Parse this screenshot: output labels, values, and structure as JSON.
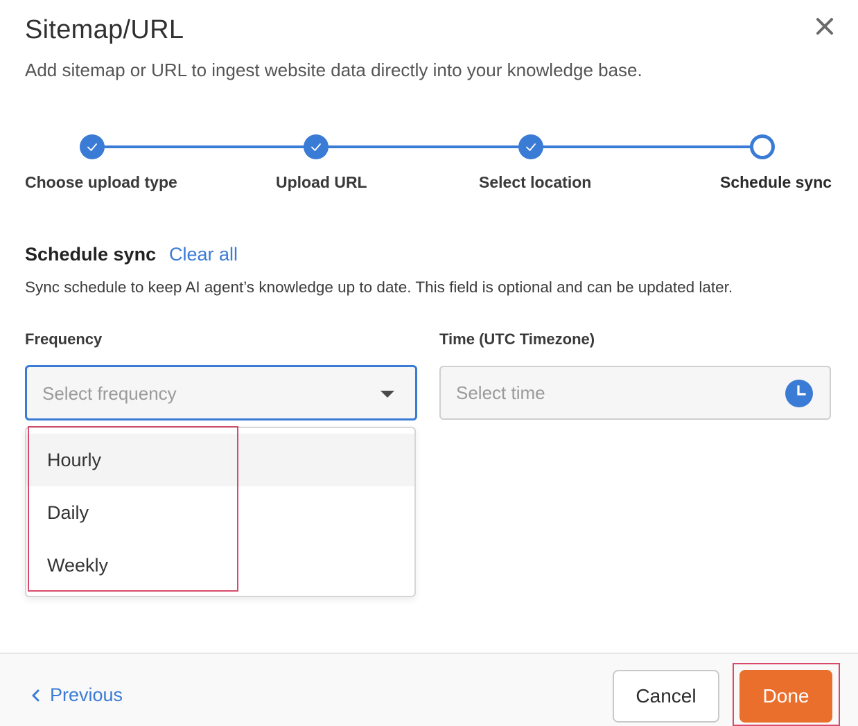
{
  "dialog": {
    "title": "Sitemap/URL",
    "subtitle": "Add sitemap or URL to ingest website data directly into your knowledge base."
  },
  "stepper": {
    "steps": [
      {
        "label": "Choose upload type",
        "state": "complete"
      },
      {
        "label": "Upload URL",
        "state": "complete"
      },
      {
        "label": "Select location",
        "state": "complete"
      },
      {
        "label": "Schedule sync",
        "state": "current"
      }
    ]
  },
  "schedule": {
    "title": "Schedule sync",
    "clear_all": "Clear all",
    "description": "Sync schedule to keep AI agent’s knowledge up to date. This field is optional and can be updated later.",
    "frequency": {
      "label": "Frequency",
      "placeholder": "Select frequency",
      "options": [
        "Hourly",
        "Daily",
        "Weekly"
      ],
      "hovered_option": "Hourly"
    },
    "time": {
      "label": "Time (UTC Timezone)",
      "placeholder": "Select time"
    }
  },
  "footer": {
    "previous": "Previous",
    "cancel": "Cancel",
    "done": "Done"
  },
  "colors": {
    "accent": "#3a7bd5",
    "primary_button": "#ea6f2d",
    "highlight_border": "#d84a6c"
  },
  "icons": {
    "close": "close-icon",
    "check": "check-icon",
    "caret": "chevron-down-icon",
    "clock": "clock-icon",
    "previous": "chevron-left-icon"
  }
}
